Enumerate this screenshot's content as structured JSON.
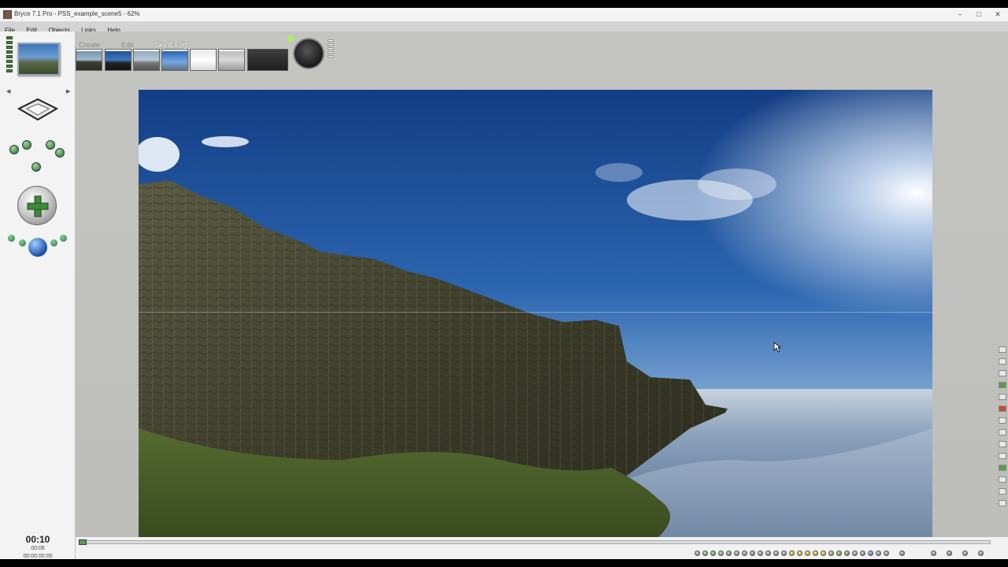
{
  "window": {
    "title": "Bryce 7.1 Pro - PSS_example_scene5 - 62%"
  },
  "menu": [
    "File",
    "Edit",
    "Objects",
    "Links",
    "Help"
  ],
  "toolbar": {
    "tabs": [
      "Create",
      "Edit",
      "Sky & Fog"
    ],
    "active_tab": "Sky & Fog",
    "presets": [
      "sky preset 1",
      "sky preset 2",
      "sky preset 3",
      "sky preset 4",
      "sky preset 5",
      "sky preset 6"
    ]
  },
  "left_panel": {
    "clock_main": "00:10",
    "clock_sub": "00:06",
    "clock_frames": "00:00:00:00"
  },
  "colors": {
    "sky_top": "#1a4b93",
    "sky_horizon": "#8fb8df",
    "sea": "#6a86a8",
    "cliff": "#4b4a34",
    "grass": "#4c5e29",
    "app_bg": "#c9c9c9"
  }
}
